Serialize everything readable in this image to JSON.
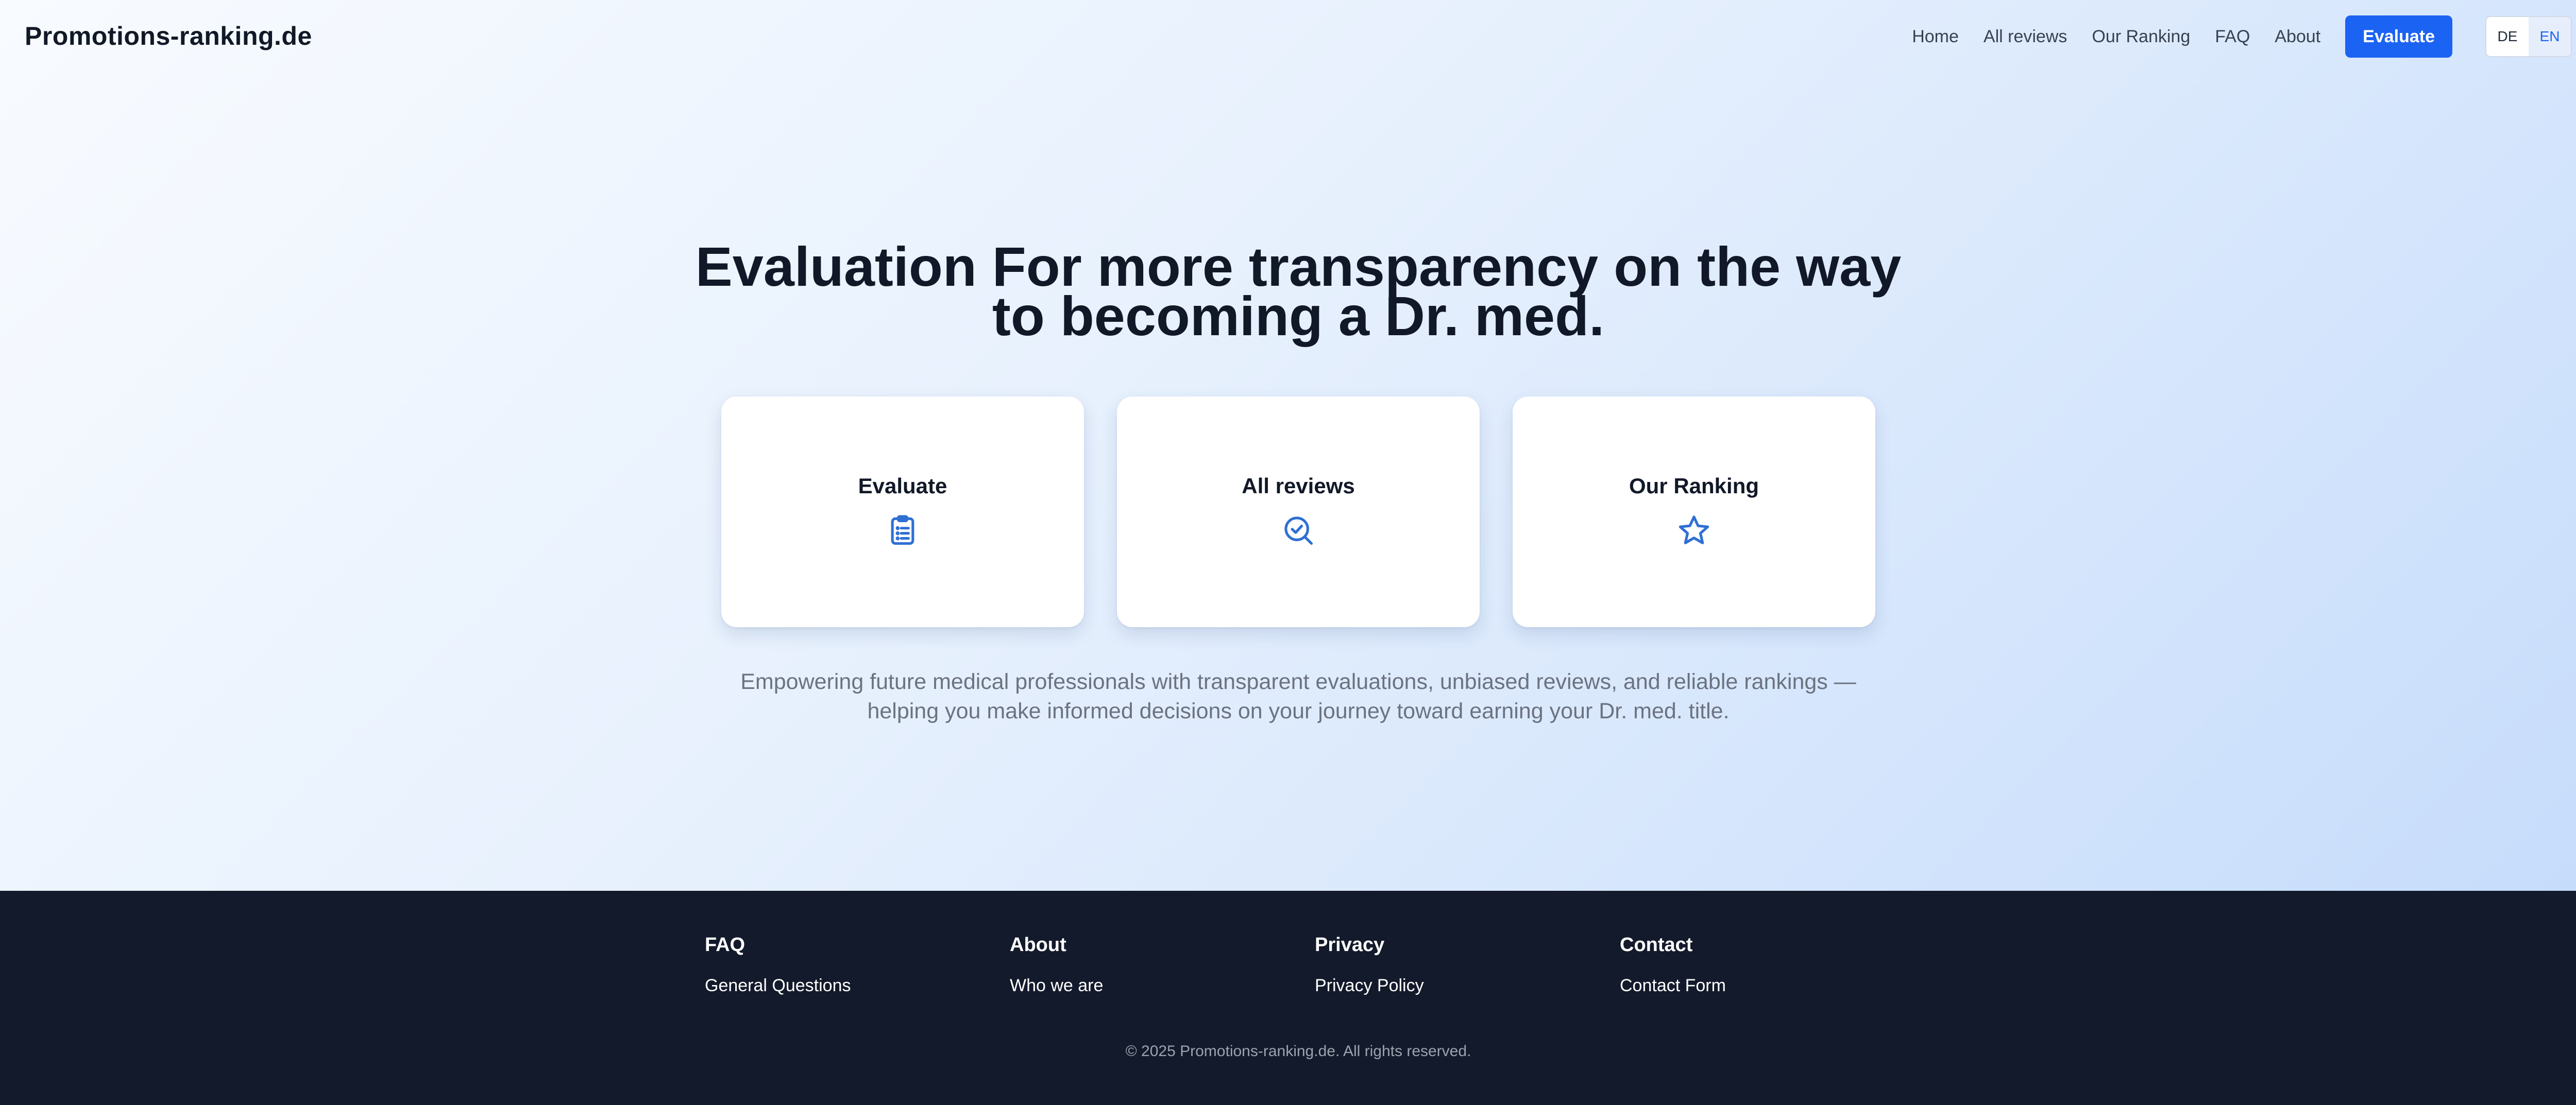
{
  "header": {
    "logo": "Promotions-ranking.de",
    "nav": [
      "Home",
      "All reviews",
      "Our Ranking",
      "FAQ",
      "About"
    ],
    "cta": "Evaluate",
    "languages": [
      "DE",
      "EN"
    ],
    "active_language": "EN"
  },
  "hero": {
    "title": "Evaluation For more transparency on the way to becoming a Dr. med.",
    "cards": [
      {
        "label": "Evaluate",
        "icon": "clipboard-list-icon"
      },
      {
        "label": "All reviews",
        "icon": "search-check-icon"
      },
      {
        "label": "Our Ranking",
        "icon": "star-icon"
      }
    ],
    "description": "Empowering future medical professionals with transparent evaluations, unbiased reviews, and reliable rankings — helping you make informed decisions on your journey toward earning your Dr. med. title."
  },
  "footer": {
    "columns": [
      {
        "heading": "FAQ",
        "link": "General Questions"
      },
      {
        "heading": "About",
        "link": "Who we are"
      },
      {
        "heading": "Privacy",
        "link": "Privacy Policy"
      },
      {
        "heading": "Contact",
        "link": "Contact Form"
      }
    ],
    "copyright": "© 2025 Promotions-ranking.de. All rights reserved."
  },
  "colors": {
    "accent": "#1b63f2",
    "icon": "#2f6fd4",
    "footer_bg": "#131a2b",
    "text_dark": "#111827",
    "text_muted": "#6b7280"
  }
}
